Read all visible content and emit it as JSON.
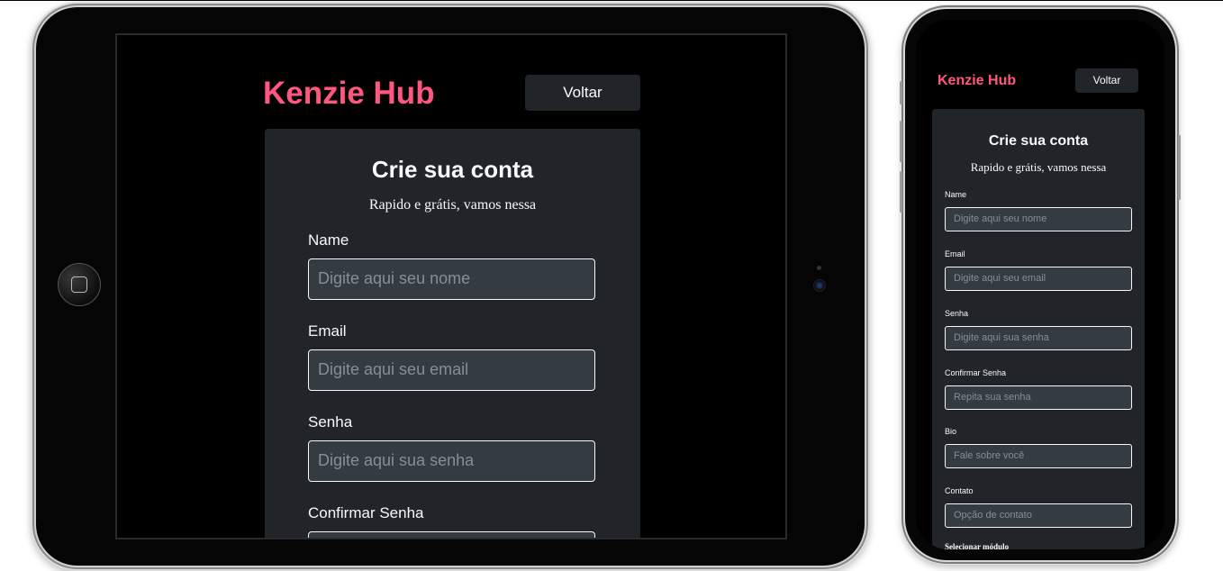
{
  "brand": {
    "logo": "Kenzie Hub",
    "accent": "#ff577f"
  },
  "header": {
    "back_label": "Voltar"
  },
  "form": {
    "title": "Crie sua conta",
    "subtitle": "Rapido e grátis, vamos nessa",
    "fields": [
      {
        "label": "Name",
        "placeholder": "Digite aqui seu nome"
      },
      {
        "label": "Email",
        "placeholder": "Digite aqui seu email"
      },
      {
        "label": "Senha",
        "placeholder": "Digite aqui sua senha"
      },
      {
        "label": "Confirmar Senha",
        "placeholder": "Repita sua senha"
      },
      {
        "label": "Bio",
        "placeholder": "Fale sobre você"
      },
      {
        "label": "Contato",
        "placeholder": "Opção de contato"
      }
    ],
    "module_label": "Selecionar módulo"
  },
  "colors": {
    "background": "#000000",
    "card": "#212529",
    "input_bg": "#343b41",
    "placeholder": "#868e96",
    "text": "#f8f9fa"
  }
}
